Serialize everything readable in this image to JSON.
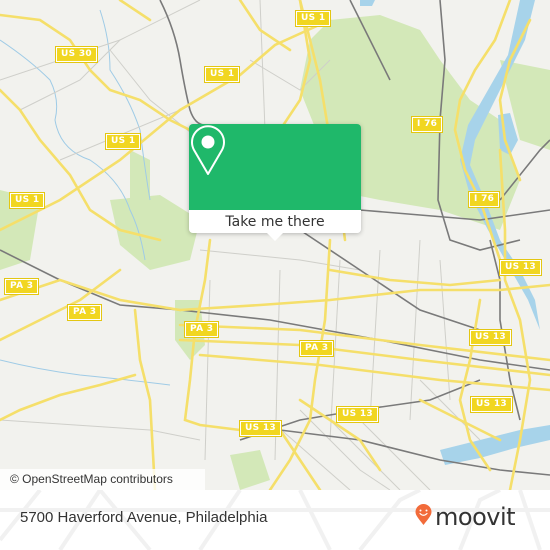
{
  "map": {
    "colors": {
      "background": "#f2f2ee",
      "park": "#d3e8b8",
      "water": "#a7d3ea",
      "major_road": "#f5df6a",
      "minor_road": "#c9c9c4",
      "railway": "#7a7a7a",
      "shield": "#f1d621"
    },
    "road_shields": [
      {
        "label": "US 30"
      },
      {
        "label": "US 1"
      },
      {
        "label": "US 1"
      },
      {
        "label": "US 1"
      },
      {
        "label": "US 1"
      },
      {
        "label": "I 76"
      },
      {
        "label": "I 76"
      },
      {
        "label": "US 13"
      },
      {
        "label": "PA 3"
      },
      {
        "label": "PA 3"
      },
      {
        "label": "PA 3"
      },
      {
        "label": "PA 3"
      },
      {
        "label": "US 13"
      },
      {
        "label": "US 13"
      },
      {
        "label": "US 13"
      },
      {
        "label": "US 13"
      },
      {
        "label": "US 1"
      }
    ],
    "attribution": "© OpenStreetMap contributors"
  },
  "popup": {
    "icon": "map-pin-icon",
    "button_label": "Take me there",
    "color": "#1fb86a"
  },
  "footer": {
    "address": "5700 Haverford Avenue, Philadelphia",
    "brand": "moovit",
    "brand_icon": "moovit-pin-icon",
    "brand_color": "#f26b3a"
  }
}
